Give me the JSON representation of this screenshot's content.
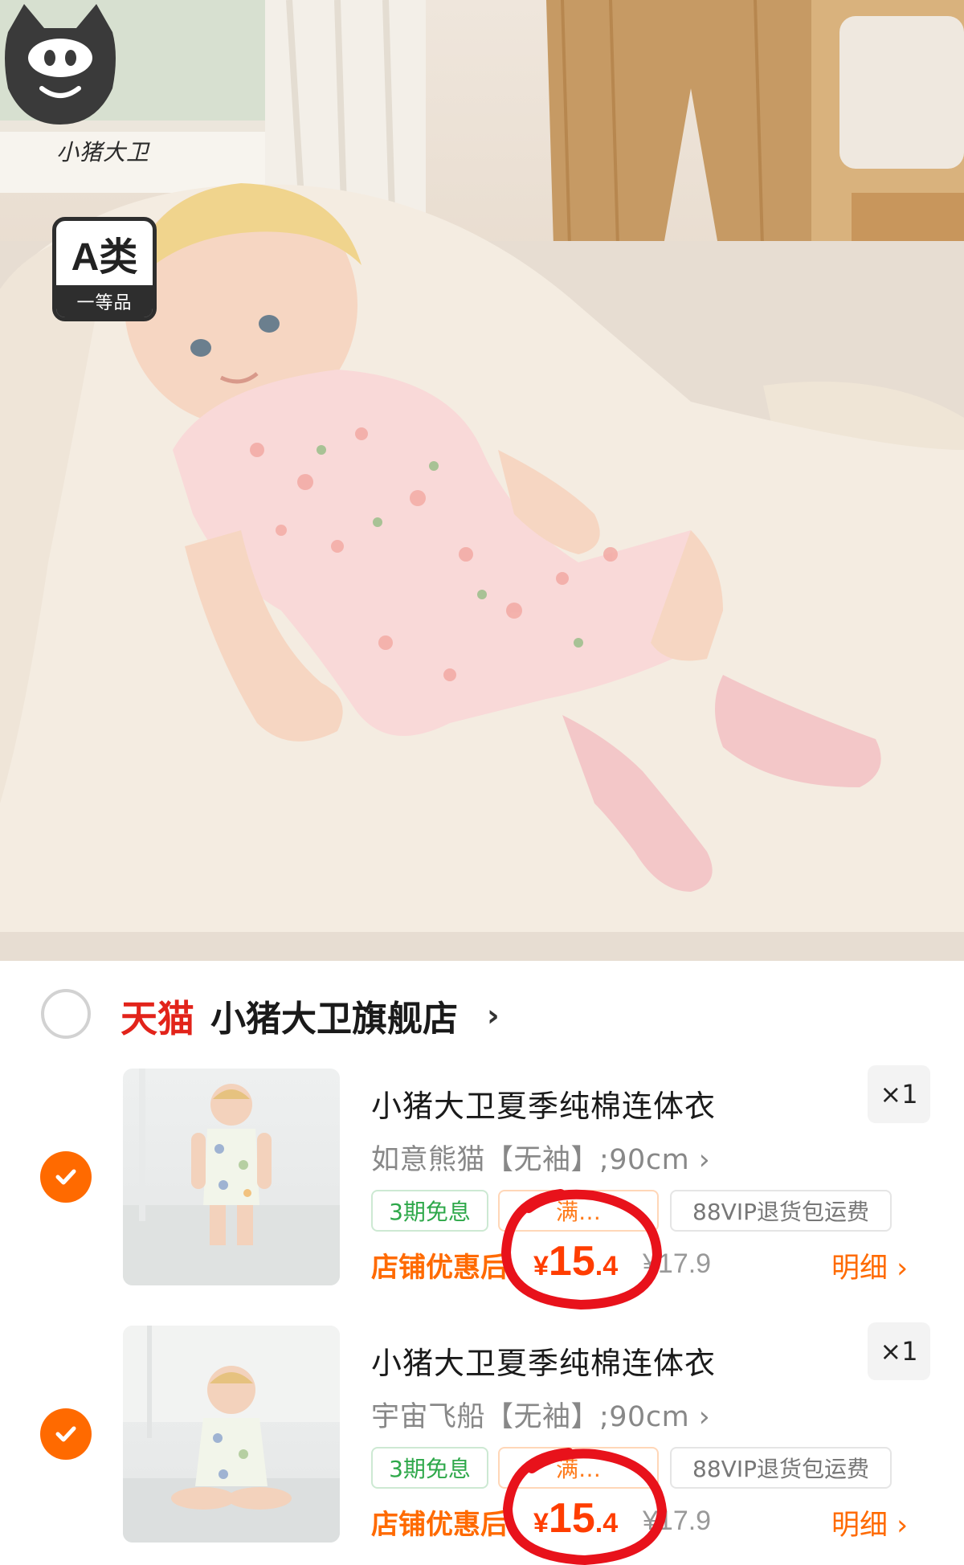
{
  "hero": {
    "brand_name": "小猪大卫",
    "grade_badge": {
      "top": "A类",
      "bottom": "一等品"
    }
  },
  "shop": {
    "platform": "天猫",
    "name": "小猪大卫旗舰店",
    "chevron": "›"
  },
  "items": [
    {
      "title": "小猪大卫夏季纯棉连体衣",
      "quantity": "×1",
      "spec": "如意熊猫【无袖】;90cm ›",
      "tags": [
        "3期免息",
        "满…",
        "88VIP退货包运费"
      ],
      "shop_discount": "店铺优惠后",
      "price_yen": "¥",
      "price_int": "15",
      "price_dec": ".4",
      "original_price": "¥17.9",
      "detail": "明细 ›",
      "selected": true
    },
    {
      "title": "小猪大卫夏季纯棉连体衣",
      "quantity": "×1",
      "spec": "宇宙飞船【无袖】;90cm ›",
      "tags": [
        "3期免息",
        "满…",
        "88VIP退货包运费"
      ],
      "shop_discount": "店铺优惠后",
      "price_yen": "¥",
      "price_int": "15",
      "price_dec": ".4",
      "original_price": "¥17.9",
      "detail": "明细 ›",
      "selected": true
    }
  ],
  "colors": {
    "accent_orange": "#ff6a00",
    "price_red": "#ff3d00",
    "tmall_red": "#e2231a",
    "annotation_red": "#e8121b",
    "tag_green": "#2ea84a"
  },
  "icons": {
    "brand_logo": "pig-face-icon",
    "shop_radio": "radio-unchecked-icon",
    "item_check": "check-circle-icon"
  }
}
